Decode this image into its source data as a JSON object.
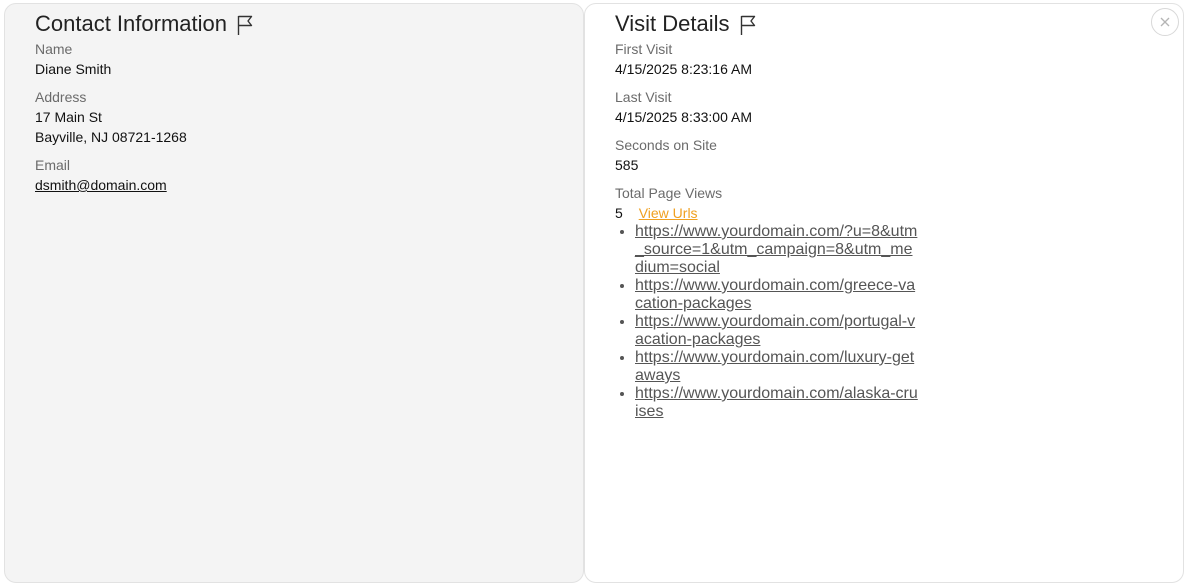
{
  "contact": {
    "title": "Contact Information",
    "name_label": "Name",
    "name_value": "Diane Smith",
    "address_label": "Address",
    "address_line1": "17 Main St",
    "address_line2": "Bayville, NJ 08721-1268",
    "email_label": "Email",
    "email_value": "dsmith@domain.com"
  },
  "visit": {
    "title": "Visit Details",
    "first_visit_label": "First Visit",
    "first_visit_value": "4/15/2025 8:23:16 AM",
    "last_visit_label": "Last Visit",
    "last_visit_value": "4/15/2025 8:33:00 AM",
    "seconds_label": "Seconds on Site",
    "seconds_value": "585",
    "page_views_label": "Total Page Views",
    "page_views_value": "5",
    "view_urls_label": "View Urls",
    "urls": [
      "https://www.yourdomain.com/?u=8&utm_source=1&utm_campaign=8&utm_medium=social",
      "https://www.yourdomain.com/greece-vacation-packages",
      "https://www.yourdomain.com/portugal-vacation-packages",
      "https://www.yourdomain.com/luxury-getaways",
      "https://www.yourdomain.com/alaska-cruises"
    ]
  },
  "icons": {
    "flag": "flag-icon",
    "close": "close-icon"
  },
  "colors": {
    "contact_panel_bg": "#f4f4f4",
    "link_accent": "#f0a020"
  }
}
